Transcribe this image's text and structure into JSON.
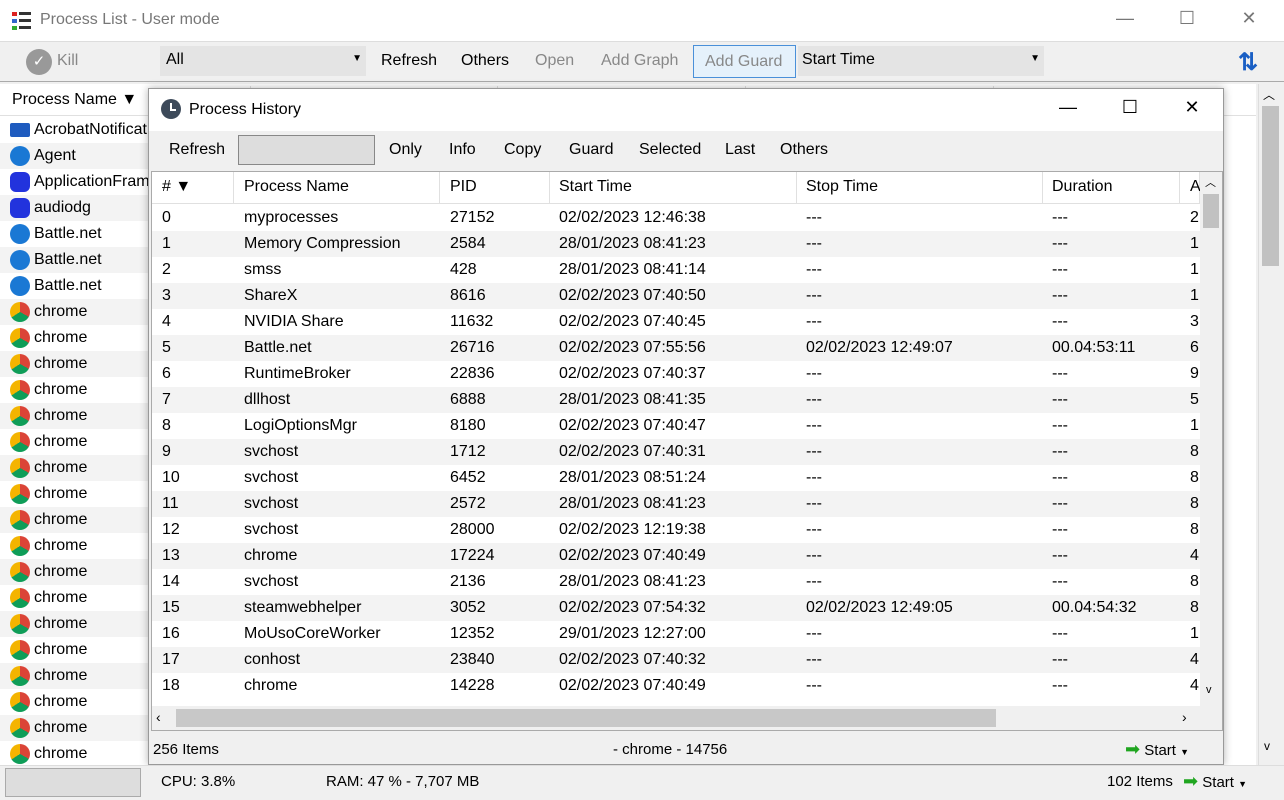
{
  "window": {
    "title": "Process List - User mode"
  },
  "toolbar": {
    "kill": "Kill",
    "filter": "All",
    "refresh": "Refresh",
    "others": "Others",
    "open": "Open",
    "add_graph": "Add Graph",
    "add_guard": "Add Guard",
    "sort": "Start Time"
  },
  "main_list": {
    "header": "Process Name ▼",
    "items": [
      {
        "name": "AcrobatNotificationClient",
        "icon": "acrobat-icon"
      },
      {
        "name": "Agent",
        "icon": "battlenet-icon"
      },
      {
        "name": "ApplicationFrameHost",
        "icon": "gear-icon"
      },
      {
        "name": "audiodg",
        "icon": "gear-icon"
      },
      {
        "name": "Battle.net",
        "icon": "battlenet-icon"
      },
      {
        "name": "Battle.net",
        "icon": "battlenet-icon"
      },
      {
        "name": "Battle.net",
        "icon": "battlenet-icon"
      },
      {
        "name": "chrome",
        "icon": "chrome-icon"
      },
      {
        "name": "chrome",
        "icon": "chrome-icon"
      },
      {
        "name": "chrome",
        "icon": "chrome-icon"
      },
      {
        "name": "chrome",
        "icon": "chrome-icon"
      },
      {
        "name": "chrome",
        "icon": "chrome-icon"
      },
      {
        "name": "chrome",
        "icon": "chrome-icon"
      },
      {
        "name": "chrome",
        "icon": "chrome-icon"
      },
      {
        "name": "chrome",
        "icon": "chrome-icon"
      },
      {
        "name": "chrome",
        "icon": "chrome-icon"
      },
      {
        "name": "chrome",
        "icon": "chrome-icon"
      },
      {
        "name": "chrome",
        "icon": "chrome-icon"
      },
      {
        "name": "chrome",
        "icon": "chrome-icon"
      },
      {
        "name": "chrome",
        "icon": "chrome-icon"
      },
      {
        "name": "chrome",
        "icon": "chrome-icon"
      },
      {
        "name": "chrome",
        "icon": "chrome-icon"
      },
      {
        "name": "chrome",
        "icon": "chrome-icon"
      },
      {
        "name": "chrome",
        "icon": "chrome-icon"
      },
      {
        "name": "chrome",
        "icon": "chrome-icon"
      }
    ]
  },
  "dialog": {
    "title": "Process History",
    "toolbar": {
      "refresh": "Refresh",
      "only": "Only",
      "info": "Info",
      "copy": "Copy",
      "guard": "Guard",
      "selected": "Selected",
      "last": "Last",
      "others": "Others"
    },
    "columns": [
      "# ▼",
      "Process Name",
      "PID",
      "Start Time",
      "Stop Time",
      "Duration",
      "A"
    ],
    "rows": [
      [
        "0",
        "myprocesses",
        "27152",
        "02/02/2023 12:46:38",
        "---",
        "---",
        "2"
      ],
      [
        "1",
        "Memory Compression",
        "2584",
        "28/01/2023 08:41:23",
        "---",
        "---",
        "1"
      ],
      [
        "2",
        "smss",
        "428",
        "28/01/2023 08:41:14",
        "---",
        "---",
        "1"
      ],
      [
        "3",
        "ShareX",
        "8616",
        "02/02/2023 07:40:50",
        "---",
        "---",
        "1"
      ],
      [
        "4",
        "NVIDIA Share",
        "11632",
        "02/02/2023 07:40:45",
        "---",
        "---",
        "3"
      ],
      [
        "5",
        "Battle.net",
        "26716",
        "02/02/2023 07:55:56",
        "02/02/2023 12:49:07",
        "00.04:53:11",
        "6"
      ],
      [
        "6",
        "RuntimeBroker",
        "22836",
        "02/02/2023 07:40:37",
        "---",
        "---",
        "9"
      ],
      [
        "7",
        "dllhost",
        "6888",
        "28/01/2023 08:41:35",
        "---",
        "---",
        "5"
      ],
      [
        "8",
        "LogiOptionsMgr",
        "8180",
        "02/02/2023 07:40:47",
        "---",
        "---",
        "1"
      ],
      [
        "9",
        "svchost",
        "1712",
        "02/02/2023 07:40:31",
        "---",
        "---",
        "8"
      ],
      [
        "10",
        "svchost",
        "6452",
        "28/01/2023 08:51:24",
        "---",
        "---",
        "8"
      ],
      [
        "11",
        "svchost",
        "2572",
        "28/01/2023 08:41:23",
        "---",
        "---",
        "8"
      ],
      [
        "12",
        "svchost",
        "28000",
        "02/02/2023 12:19:38",
        "---",
        "---",
        "8"
      ],
      [
        "13",
        "chrome",
        "17224",
        "02/02/2023 07:40:49",
        "---",
        "---",
        "4"
      ],
      [
        "14",
        "svchost",
        "2136",
        "28/01/2023 08:41:23",
        "---",
        "---",
        "8"
      ],
      [
        "15",
        "steamwebhelper",
        "3052",
        "02/02/2023 07:54:32",
        "02/02/2023 12:49:05",
        "00.04:54:32",
        "8"
      ],
      [
        "16",
        "MoUsoCoreWorker",
        "12352",
        "29/01/2023 12:27:00",
        "---",
        "---",
        "1"
      ],
      [
        "17",
        "conhost",
        "23840",
        "02/02/2023 07:40:32",
        "---",
        "---",
        "4"
      ],
      [
        "18",
        "chrome",
        "14228",
        "02/02/2023 07:40:49",
        "---",
        "---",
        "4"
      ]
    ],
    "status": {
      "items": "256 Items",
      "selected": "- chrome - 14756",
      "start": "Start"
    }
  },
  "statusbar": {
    "cpu": "CPU: 3.8%",
    "ram": "RAM: 47 % - 7,707 MB",
    "items": "102 Items",
    "start": "Start"
  }
}
